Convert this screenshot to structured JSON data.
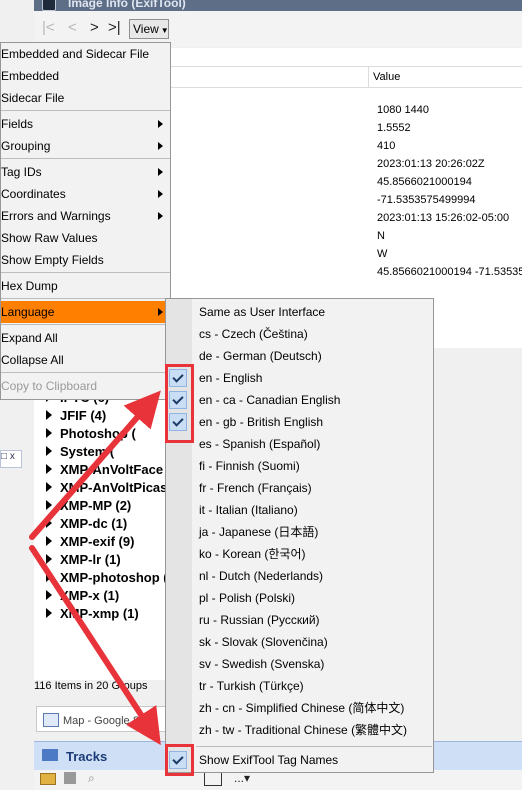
{
  "window": {
    "title": "Image Info (ExifTool)"
  },
  "toolbar": {
    "view_label": "View",
    "nav": [
      "|<",
      "<",
      ">",
      ">|"
    ]
  },
  "table": {
    "value_header": "Value",
    "values": [
      "1080 1440",
      "1.5552",
      "410",
      "2023:01:13 20:26:02Z",
      "45.8566021000194",
      "-71.5353575499994",
      "2023:01:13 15:26:02-05:00",
      "N",
      "W",
      "45.8566021000194 -71.53535"
    ]
  },
  "tree": {
    "nodes": [
      "IPTC (6)",
      "JFIF (4)",
      "Photoshop (",
      "System (",
      "XMP-AnVoltFace",
      "XMP-AnVoltPicas",
      "XMP-MP (2)",
      "XMP-dc (1)",
      "XMP-exif (9)",
      "XMP-lr (1)",
      "XMP-photoshop (",
      "XMP-x (1)",
      "XMP-xmp (1)"
    ]
  },
  "status": {
    "text": "116 Items in 20 Groups"
  },
  "panels": {
    "map_label": "Map - Google S",
    "tracks_label": "Tracks"
  },
  "menu": {
    "items": [
      {
        "label": "Embedded and Sidecar File"
      },
      {
        "label": "Embedded"
      },
      {
        "label": "Sidecar File"
      },
      {
        "label": "Fields"
      },
      {
        "label": "Grouping"
      },
      {
        "label": "Tag IDs"
      },
      {
        "label": "Coordinates"
      },
      {
        "label": "Errors and Warnings"
      },
      {
        "label": "Show Raw Values"
      },
      {
        "label": "Show Empty Fields"
      },
      {
        "label": "Hex Dump"
      },
      {
        "label": "Language"
      },
      {
        "label": "Expand All"
      },
      {
        "label": "Collapse All"
      },
      {
        "label": "Copy to Clipboard"
      }
    ]
  },
  "language_menu": {
    "items": [
      {
        "label": "Same as User Interface",
        "checked": false
      },
      {
        "label": "cs - Czech (Čeština)",
        "checked": false
      },
      {
        "label": "de - German (Deutsch)",
        "checked": false
      },
      {
        "label": "en - English",
        "checked": true
      },
      {
        "label": "en - ca - Canadian English",
        "checked": true
      },
      {
        "label": "en - gb - British English",
        "checked": true
      },
      {
        "label": "es - Spanish (Español)",
        "checked": false
      },
      {
        "label": "fi - Finnish (Suomi)",
        "checked": false
      },
      {
        "label": "fr - French (Français)",
        "checked": false
      },
      {
        "label": "it - Italian (Italiano)",
        "checked": false
      },
      {
        "label": "ja - Japanese (日本語)",
        "checked": false
      },
      {
        "label": "ko - Korean (한국어)",
        "checked": false
      },
      {
        "label": "nl - Dutch (Nederlands)",
        "checked": false
      },
      {
        "label": "pl - Polish (Polski)",
        "checked": false
      },
      {
        "label": "ru - Russian (Русский)",
        "checked": false
      },
      {
        "label": "sk - Slovak (Slovenčina)",
        "checked": false
      },
      {
        "label": "sv - Swedish (Svenska)",
        "checked": false
      },
      {
        "label": "tr - Turkish (Türkçe)",
        "checked": false
      },
      {
        "label": "zh - cn - Simplified Chinese (简体中文)",
        "checked": false
      },
      {
        "label": "zh - tw - Traditional Chinese (繁體中文)",
        "checked": false
      },
      {
        "label": "Show ExifTool Tag Names",
        "checked": true
      }
    ]
  },
  "colors": {
    "highlight": "#ff7f00",
    "annotation": "#e8333a"
  }
}
